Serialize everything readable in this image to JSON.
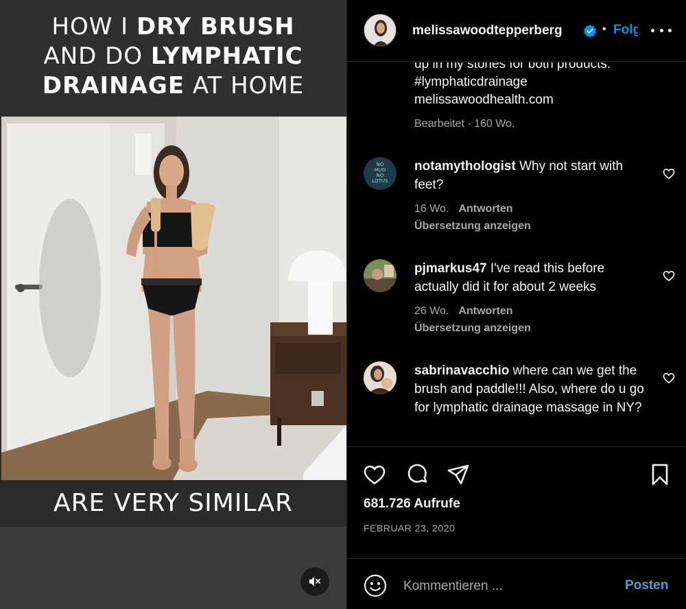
{
  "video": {
    "caption_top_line1_a": "HOW I ",
    "caption_top_line1_b": "DRY BRUSH",
    "caption_top_line2_a": "AND DO ",
    "caption_top_line2_b": "LYMPHATIC",
    "caption_top_line3_a": "DRAINAGE",
    "caption_top_line3_b": " AT HOME",
    "caption_bottom": "ARE VERY SIMILAR",
    "mute_icon": "speaker-muted-icon"
  },
  "header": {
    "username": "melissawoodtepperberg",
    "verified_icon": "verified-badge-icon",
    "separator": "•",
    "follow_label": "Folgen",
    "more_icon": "more-options-icon"
  },
  "caption": {
    "tail_line1": "up in my stories for both products.",
    "hashtag": "#lymphaticdrainage",
    "link": "melissawoodhealth.com",
    "meta": "Bearbeitet · 160 Wo."
  },
  "comments": [
    {
      "user": "notamythologist",
      "text": "Why not start with feet?",
      "age": "16 Wo.",
      "reply_label": "Antworten",
      "translate_label": "Übersetzung anzeigen",
      "avatar_text": "NO MUD NO LOTUS"
    },
    {
      "user": "pjmarkus47",
      "text": "I've read this before actually did it for about 2 weeks",
      "age": "26 Wo.",
      "reply_label": "Antworten",
      "translate_label": "Übersetzung anzeigen"
    },
    {
      "user": "sabrinavacchio",
      "text": "where can we get the brush and paddle!!! Also, where do u go for lymphatic drainage massage in NY?"
    }
  ],
  "actions": {
    "views": "681.726 Aufrufe",
    "date": "FEBRUAR 23, 2020",
    "icons": [
      "heart-icon",
      "comment-icon",
      "share-icon",
      "bookmark-icon"
    ]
  },
  "composer": {
    "placeholder": "Kommentieren ...",
    "post_label": "Posten",
    "emoji_icon": "emoji-icon"
  },
  "colors": {
    "accent": "#0095f6",
    "post": "#4a9eda",
    "muted_text": "#a8a8a8",
    "background": "#000000"
  }
}
